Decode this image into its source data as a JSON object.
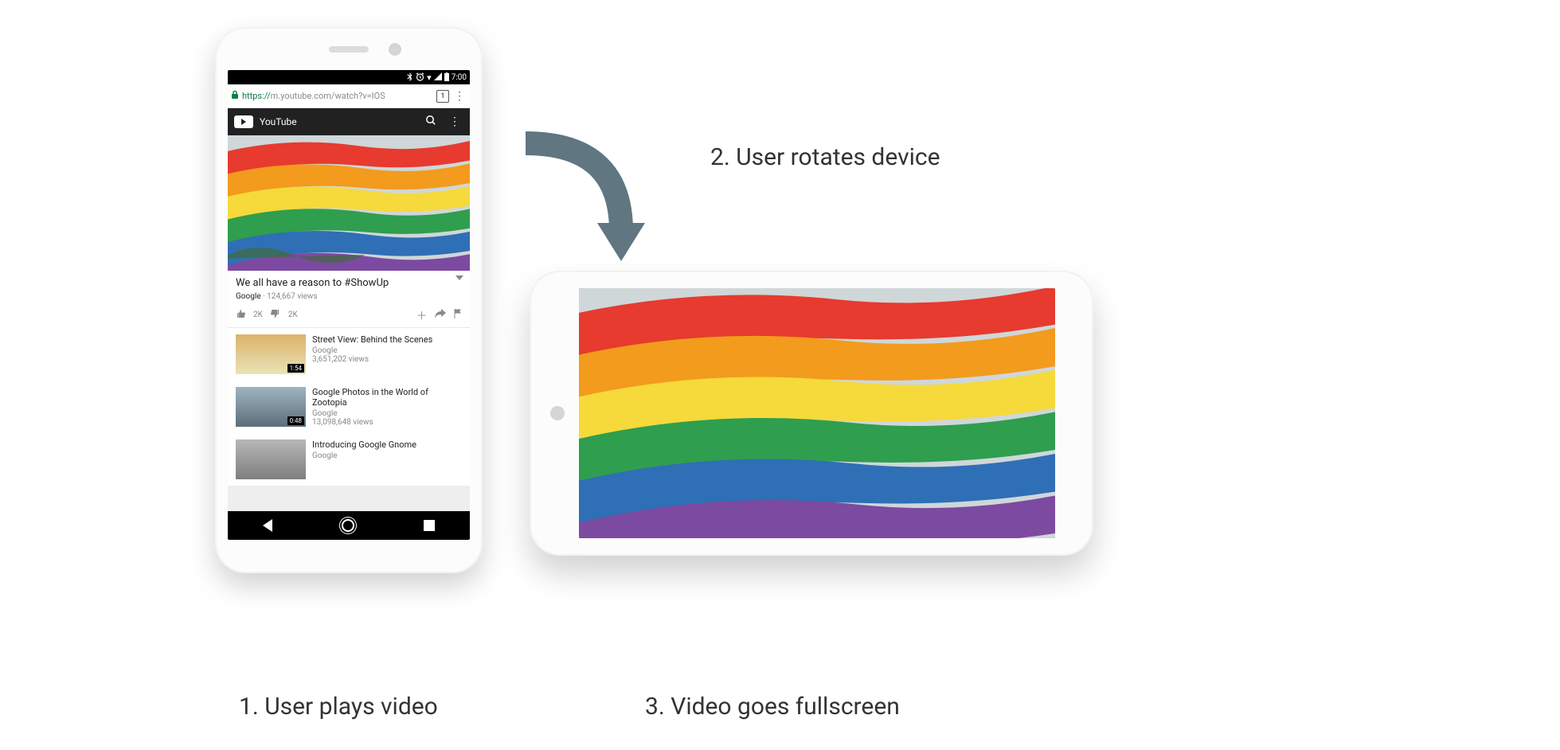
{
  "captions": {
    "step1": "1. User plays video",
    "step2": "2. User rotates device",
    "step3": "3. Video goes fullscreen"
  },
  "statusbar": {
    "bluetooth_icon": "bluetooth-icon",
    "alarm_icon": "alarm-icon",
    "wifi_icon": "wifi-icon",
    "signal_icon": "signal-icon",
    "battery_icon": "battery-icon",
    "time": "7:00"
  },
  "browser": {
    "url_scheme": "https://",
    "url_rest": "m.youtube.com/watch?v=IOS",
    "tab_count": "1"
  },
  "youtube": {
    "brand": "YouTube",
    "search_icon": "search-icon",
    "menu_icon": "kebab-icon"
  },
  "video": {
    "title": "We all have a reason to #ShowUp",
    "channel": "Google",
    "views": "124,667 views",
    "likes": "2K",
    "dislikes": "2K"
  },
  "recommendations": [
    {
      "title": "Street View: Behind the Scenes",
      "channel": "Google",
      "views": "3,651,202 views",
      "duration": "1:54"
    },
    {
      "title": "Google Photos in the World of Zootopia",
      "channel": "Google",
      "views": "13,098,648 views",
      "duration": "0:48"
    },
    {
      "title": "Introducing Google Gnome",
      "channel": "Google",
      "views": "",
      "duration": ""
    }
  ]
}
